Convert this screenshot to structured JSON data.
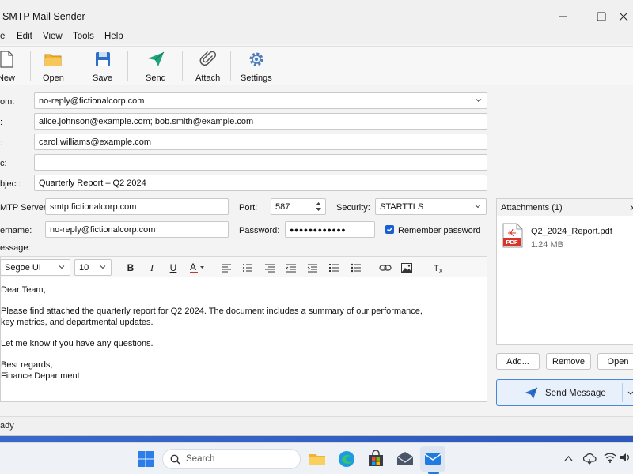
{
  "window": {
    "title": "SMTP Mail Sender"
  },
  "menu": [
    "e",
    "Edit",
    "View",
    "Tools",
    "Help"
  ],
  "toolbar": {
    "new": "New",
    "open": "Open",
    "save": "Save",
    "send": "Send",
    "attach": "Attach",
    "settings": "Settings"
  },
  "form": {
    "from_label": "om:",
    "from_value": "no-reply@fictionalcorp.com",
    "to_label": ":",
    "to_value": "alice.johnson@example.com; bob.smith@example.com",
    "cc_label": ":",
    "cc_value": "carol.williams@example.com",
    "bcc_label": "c:",
    "bcc_value": "",
    "subject_label": "bject:",
    "subject_value": "Quarterly Report – Q2 2024",
    "smtp_label": "MTP Server:",
    "smtp_value": "smtp.fictionalcorp.com",
    "port_label": "Port:",
    "port_value": "587",
    "security_label": "Security:",
    "security_value": "STARTTLS",
    "username_label": "ername:",
    "username_value": "no-reply@fictionalcorp.com",
    "password_label": "Password:",
    "password_value": "●●●●●●●●●●●●",
    "remember_label": "Remember password",
    "remember_checked": true,
    "message_label": "essage:"
  },
  "format": {
    "font": "Segoe UI",
    "size": "10"
  },
  "message": {
    "lines": [
      "Dear Team,",
      "",
      "Please find attached the quarterly report for Q2 2024. The document includes a summary of our performance,",
      "key metrics, and departmental updates.",
      "",
      "Let me know if you have any questions.",
      "",
      "Best regards,",
      "Finance Department"
    ]
  },
  "attachments": {
    "header": "Attachments (1)",
    "items": [
      {
        "name": "Q2_2024_Report.pdf",
        "size": "1.24 MB",
        "badge": "PDF"
      }
    ],
    "add": "Add...",
    "remove": "Remove",
    "open": "Open"
  },
  "send_button": "Send Message",
  "status": "ady",
  "taskbar": {
    "search_placeholder": "Search"
  },
  "colors": {
    "accent": "#1a5fd0",
    "send_green": "#1fa37a",
    "folder": "#f2b233",
    "pdf": "#d9342b"
  }
}
